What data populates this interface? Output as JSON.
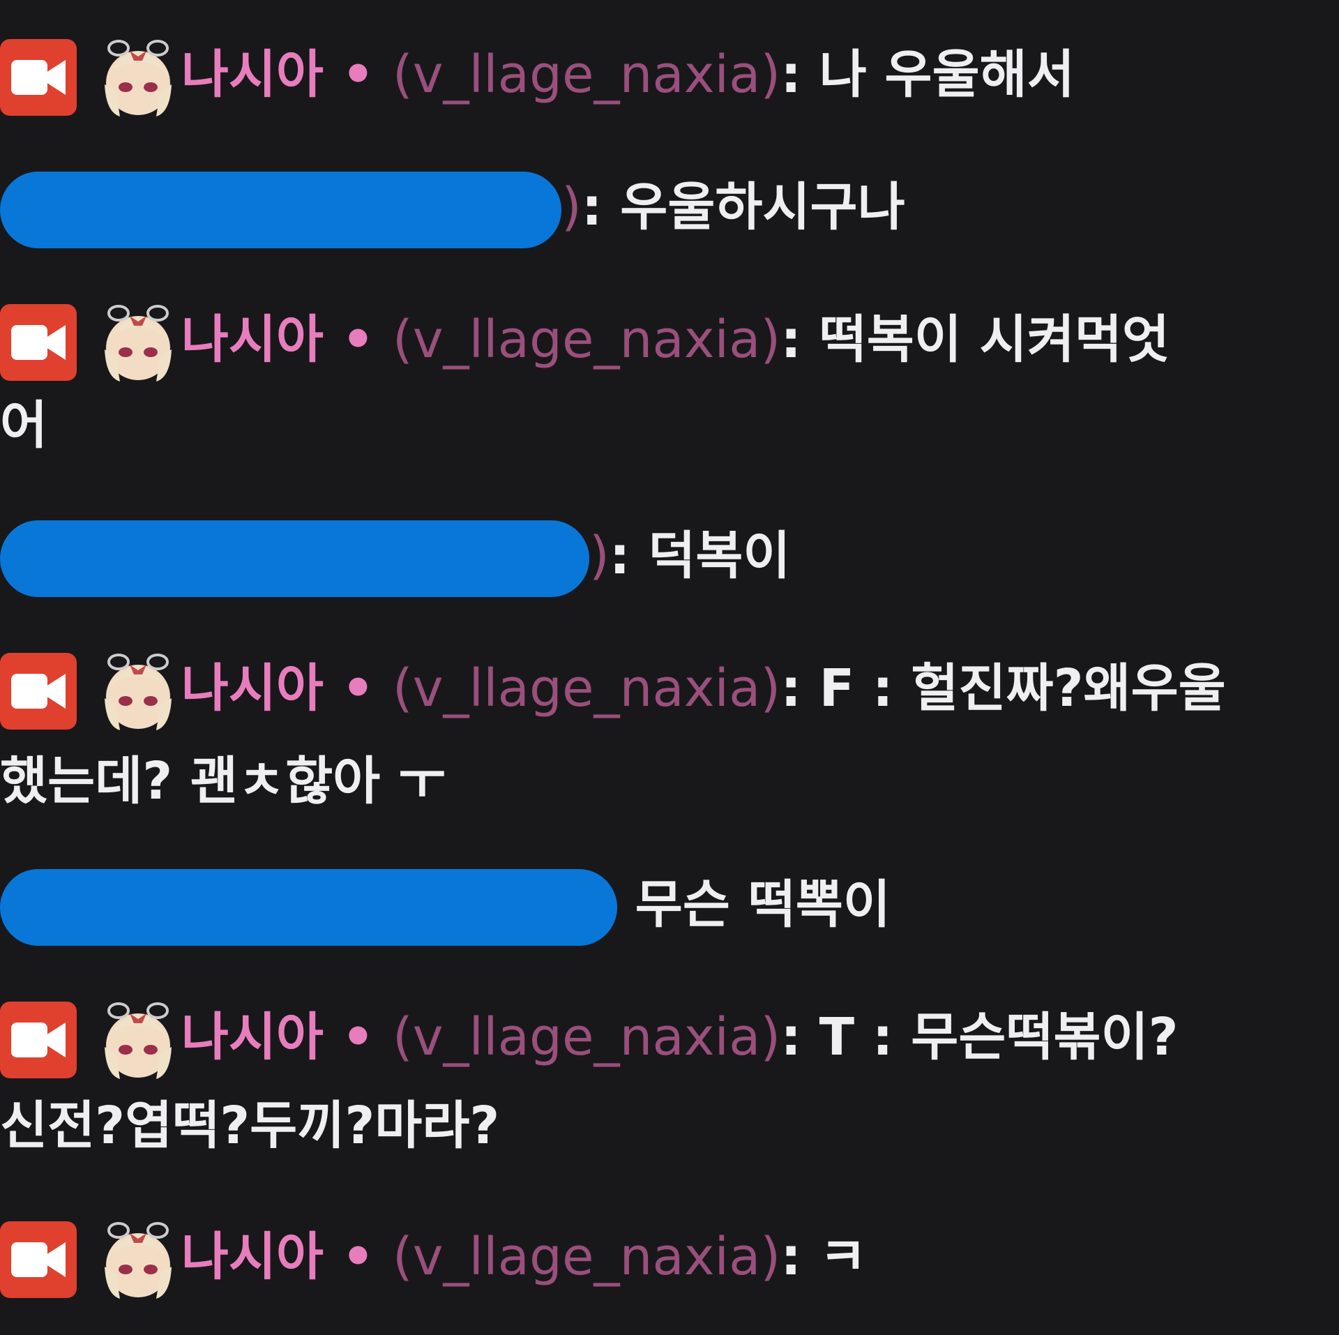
{
  "messages": [
    {
      "badge": "video-camera-icon",
      "emote": "anime-girl-emote",
      "nick": "나시아",
      "dot": "•",
      "login": "(v_llage_naxia)",
      "sep": ":",
      "text": "나 우울해서",
      "cont": ""
    },
    {
      "redacted": true,
      "tail": ")",
      "sep": ":",
      "text": "우울하시구나"
    },
    {
      "badge": "video-camera-icon",
      "emote": "anime-girl-emote",
      "nick": "나시아",
      "dot": "•",
      "login": "(v_llage_naxia)",
      "sep": ":",
      "text": "떡복이 시켜먹엇",
      "cont": "어"
    },
    {
      "redacted": true,
      "tail": ")",
      "sep": ":",
      "text": "덕복이"
    },
    {
      "badge": "video-camera-icon",
      "emote": "anime-girl-emote",
      "nick": "나시아",
      "dot": "•",
      "login": "(v_llage_naxia)",
      "sep": ":",
      "text": "F : 헐진짜?왜우울",
      "cont": "했는데? 괜ㅊ핞아 ㅜ"
    },
    {
      "redacted": true,
      "tail": "",
      "sep": "",
      "text": "무슨 떡뽁이"
    },
    {
      "badge": "video-camera-icon",
      "emote": "anime-girl-emote",
      "nick": "나시아",
      "dot": "•",
      "login": "(v_llage_naxia)",
      "sep": ":",
      "text": "T : 무슨떡볶이?",
      "cont": "신전?엽떡?두끼?마라?"
    },
    {
      "badge": "video-camera-icon",
      "emote": "anime-girl-emote",
      "nick": "나시아",
      "dot": "•",
      "login": "(v_llage_naxia)",
      "sep": ":",
      "text": "ㅋ",
      "cont": ""
    }
  ],
  "colors": {
    "background": "#18181b",
    "nick": "#e87dbd",
    "login": "#9a4f7c",
    "text": "#efeff1",
    "badge": "#e0402e",
    "redaction": "#0877d8"
  }
}
